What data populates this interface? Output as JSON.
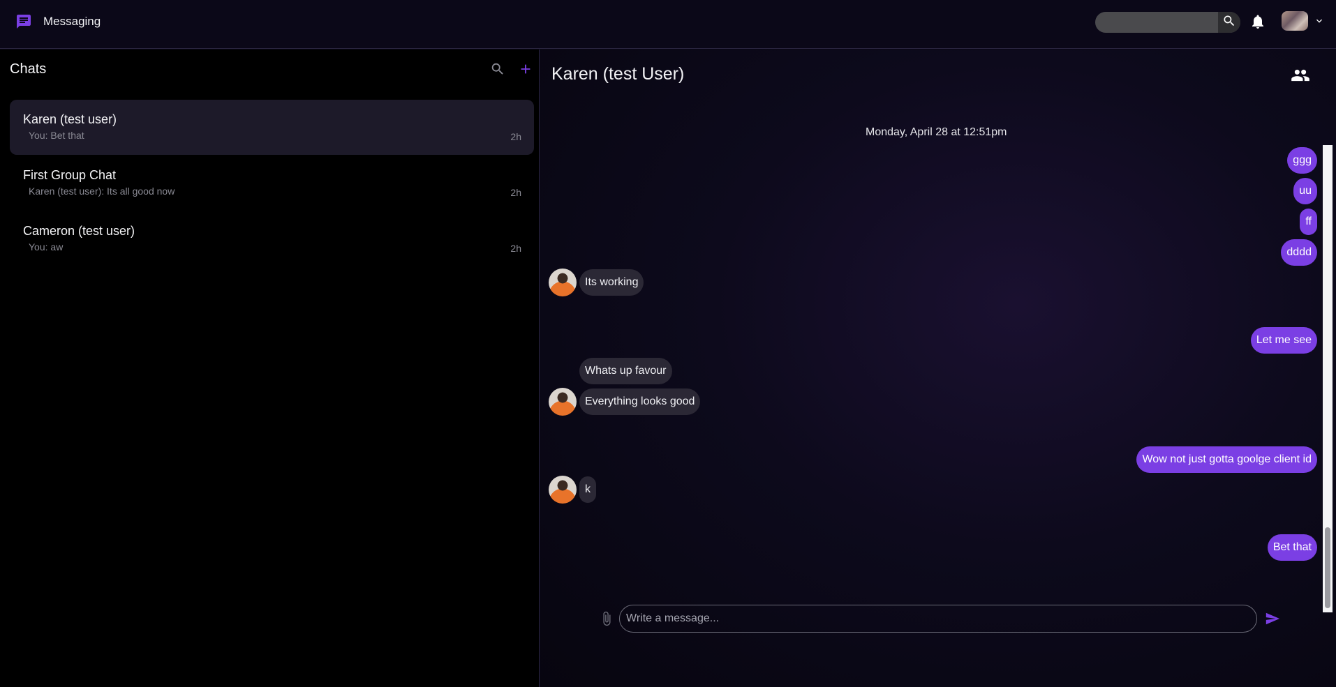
{
  "app": {
    "title": "Messaging"
  },
  "header": {
    "search_placeholder": "",
    "icons": [
      "chat-icon",
      "search-icon",
      "bell-icon",
      "avatar",
      "chevron-down-icon"
    ]
  },
  "sidebar": {
    "title": "Chats",
    "chats": [
      {
        "name": "Karen (test user)",
        "preview": "You: Bet that",
        "time": "2h",
        "active": true
      },
      {
        "name": "First Group Chat",
        "preview": "Karen (test user): Its all good now",
        "time": "2h",
        "active": false
      },
      {
        "name": "Cameron (test user)",
        "preview": "You: aw",
        "time": "2h",
        "active": false
      }
    ]
  },
  "conversation": {
    "title": "Karen (test User)",
    "date_separator": "Monday, April 28 at 12:51pm",
    "messages": [
      {
        "direction": "out",
        "text": "ggg"
      },
      {
        "direction": "out",
        "text": "uu"
      },
      {
        "direction": "out",
        "text": "ff"
      },
      {
        "direction": "out",
        "text": "dddd"
      },
      {
        "direction": "in",
        "text": "Its working"
      },
      {
        "direction": "out",
        "text": "Let me see"
      },
      {
        "direction": "in",
        "text": "Whats up favour"
      },
      {
        "direction": "in",
        "text": "Everything looks good"
      },
      {
        "direction": "out",
        "text": "Wow not just gotta goolge client id"
      },
      {
        "direction": "in",
        "text": "k"
      },
      {
        "direction": "out",
        "text": "Bet that"
      }
    ]
  },
  "composer": {
    "placeholder": "Write a message..."
  },
  "colors": {
    "accent": "#7b3fe4",
    "incoming_bubble": "#2b2835",
    "background": "#0a0716"
  }
}
